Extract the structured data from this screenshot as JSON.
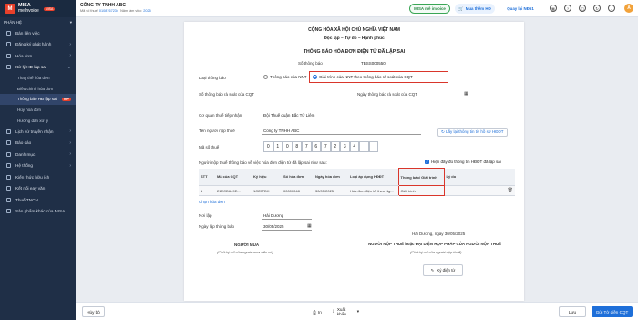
{
  "app": {
    "logo_text": "MISA",
    "logo_sub": "meInvoice",
    "logo_chip": "MISA"
  },
  "sidebar": {
    "section": "PHÂN HỆ",
    "items": [
      {
        "label": "Bán liên việc"
      },
      {
        "label": "Đăng ký phát hành"
      },
      {
        "label": "Hóa đơn"
      },
      {
        "label": "Xử lý HĐ lập sai"
      }
    ],
    "subitems": [
      {
        "label": "Thay thế hóa đơn"
      },
      {
        "label": "Điều chỉnh hóa đơn"
      },
      {
        "label": "Thông báo HĐ lập sai",
        "badge": "99+"
      },
      {
        "label": "Hủy hóa đơn"
      },
      {
        "label": "Hướng dẫn xử lý"
      }
    ],
    "items2": [
      {
        "label": "Lịch sử truyền nhận"
      },
      {
        "label": "Báo cáo"
      },
      {
        "label": "Danh mục"
      },
      {
        "label": "Hệ thống"
      },
      {
        "label": "Kiến thức hữu ích"
      },
      {
        "label": "Kết nối eay văn"
      },
      {
        "label": "Thuế TNCN"
      },
      {
        "label": "Sản phẩm khác của MISA"
      }
    ]
  },
  "topbar": {
    "company": "CÔNG TY TNHH ABC",
    "tax_label": "Mã số thuế:",
    "tax_value": "0108767234",
    "year_label": "Năm làm việc:",
    "year_value": "2025",
    "chat_btn": "MISA mê invoice",
    "buy_btn": "Mua thêm HĐ",
    "qr_btn": "Quay lại NĐ51"
  },
  "doc": {
    "nation": "CỘNG HÒA XÃ HỘI CHỦ NGHĨA VIỆT NAM",
    "motto": "Độc lập – Tự do – Hạnh phúc",
    "title": "THÔNG BÁO HÓA ĐƠN ĐIỆN TỬ ĐÃ LẬP SAI",
    "number_label": "Số thông báo",
    "number_value": "TBSS000550",
    "type_label": "Loại thông báo",
    "type_opt1": "Thông báo của NNT",
    "type_opt2": "Giải trình của NNT theo thông báo rà soát của CQT",
    "cqt_num_label": "Số thông báo rà soát của CQT",
    "cqt_date_label": "Ngày thông báo rà soát của CQT",
    "agency_label": "Cơ quan thuế tiếp nhận",
    "agency_value": "Đội Thuế quận Bắc Từ Liêm",
    "payer_label": "Tên người nộp thuế",
    "payer_value": "Công ty TNHH ABC",
    "get_info_btn": "Lấy lại thông tin từ hồ sơ HĐĐT",
    "mst_label": "Mã số thuế",
    "mst_digits": [
      "0",
      "1",
      "0",
      "8",
      "7",
      "6",
      "7",
      "2",
      "3",
      "4",
      "",
      ""
    ],
    "notify_intro": "Người nộp thuế thông báo về việc hóa đơn điện tử đã lập sai như sau:",
    "show_info": "Hiện đầy đủ thông tin HĐĐT đã lập sai",
    "table_headers": [
      "STT",
      "Mã của CQT",
      "Ký hiệu",
      "Số hóa đơn",
      "Ngày hóa đơn",
      "Loại áp dụng HĐĐT",
      "Thông báo/ Giải trình",
      "Lý do"
    ],
    "row": [
      "1",
      "21ECD649E...",
      "1C25TDK",
      "00000048",
      "30/05/2025",
      "Hóa đơn điện tử theo Ng...",
      "Giải trình",
      ""
    ],
    "choose_invoice": "Chọn hóa đơn",
    "place_label": "Nơi lập",
    "place_value": "Hải Dương",
    "date_label": "Ngày lập thông báo",
    "date_value": "30/05/2025",
    "buyer_title": "NGƯỜI MUA",
    "buyer_note": "(Chữ ký số của người mua nếu có)",
    "place_date": "Hải Dương, ngày 30/05/2025",
    "rep_title": "NGƯỜI NỘP THUẾ hoặc ĐẠI DIỆN HỢP PHÁP CỦA NGƯỜI NỘP THUẾ",
    "rep_note": "(Chữ ký số của người nộp thuế)",
    "sign_btn": "Ký điện tử"
  },
  "bottom": {
    "cancel": "Hủy bỏ",
    "print": "In",
    "export": "Xuất khẩu",
    "save": "Lưu",
    "send": "Gửi Tờ điền CQT"
  },
  "colors": {
    "accent": "#1e6fd9",
    "sidebar": "#1f2f47",
    "danger": "#d9362b"
  }
}
